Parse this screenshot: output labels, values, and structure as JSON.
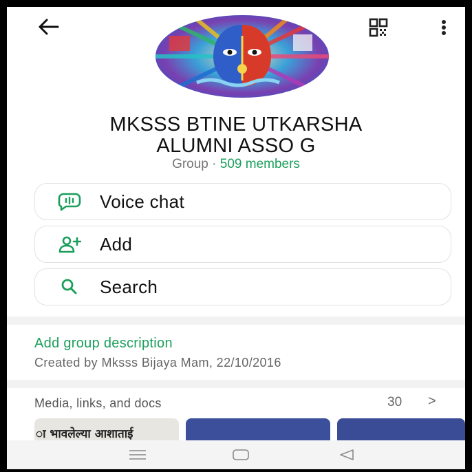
{
  "group": {
    "name_line1": "MKSSS BTINE UTKARSHA",
    "name_line2": "ALUMNI ASSO G",
    "type": "Group",
    "separator": "·",
    "members": "509 members"
  },
  "actions": {
    "voice_chat": "Voice chat",
    "add": "Add",
    "search": "Search"
  },
  "description": {
    "add_link": "Add group description",
    "created": "Created by Mksss Bijaya Mam, 22/10/2016"
  },
  "media": {
    "title": "Media, links, and docs",
    "count": "30",
    "chevron": ">",
    "thumb1_text": "ा भावलेल्या आशाताई"
  },
  "icons": {
    "back": "arrow-left-icon",
    "qr": "qr-code-icon",
    "more": "more-vertical-icon",
    "voice_chat": "voice-chat-icon",
    "add": "add-person-icon",
    "search": "search-icon",
    "nav_menu": "menu-icon",
    "nav_home": "home-icon",
    "nav_back": "triangle-back-icon"
  },
  "colors": {
    "accent": "#1a9e5a",
    "text": "#111111",
    "muted": "#777777"
  }
}
